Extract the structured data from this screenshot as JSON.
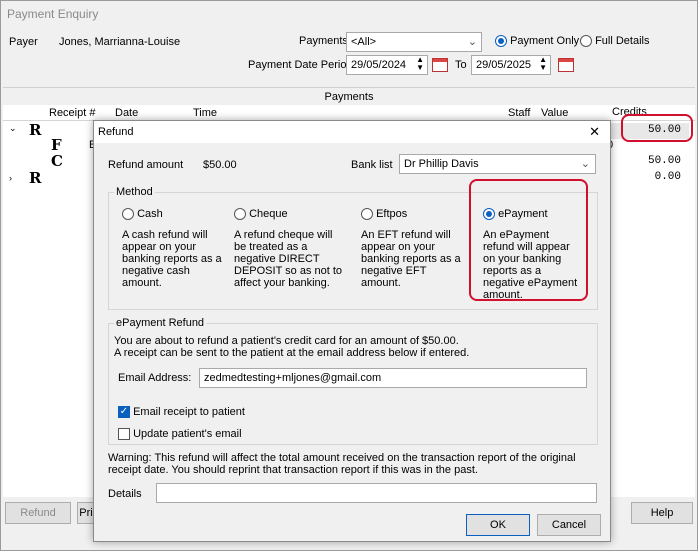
{
  "window": {
    "title": "Payment Enquiry"
  },
  "header": {
    "payer_label": "Payer",
    "payer_name": "Jones, Marrianna-Louise",
    "payments_label": "Payments",
    "payments_select": "<All>",
    "payment_only_label": "Payment Only",
    "full_details_label": "Full Details",
    "period_label": "Payment Date Period",
    "date_from": "29/05/2024",
    "to_label": "To",
    "date_to": "29/05/2025"
  },
  "grid": {
    "section_label": "Payments",
    "columns": [
      "Receipt #",
      "Date",
      "Time",
      "Staff",
      "Value",
      "Credits"
    ],
    "rows": [
      {
        "glyph": "R",
        "credits": "50.00"
      },
      {
        "glyph": "F",
        "note": "E",
        "credits": ""
      },
      {
        "glyph": "C",
        "credits": "50.00"
      },
      {
        "glyph": "R",
        "credits": "0.00"
      }
    ],
    "partial_b": "B",
    "partial_0": "0"
  },
  "bottom_buttons": {
    "refund": "Refund",
    "print": "Pri",
    "help": "Help"
  },
  "dialog": {
    "title": "Refund",
    "close": "✕",
    "refund_amount_label": "Refund amount",
    "refund_amount": "$50.00",
    "bank_list_label": "Bank list",
    "bank_list_value": "Dr Phillip Davis",
    "method_label": "Method",
    "methods": [
      {
        "label": "Cash",
        "desc": "A cash refund will appear on your banking reports as a negative cash amount."
      },
      {
        "label": "Cheque",
        "desc": "A refund cheque will be treated as a negative DIRECT DEPOSIT so as not to affect your banking."
      },
      {
        "label": "Eftpos",
        "desc": "An EFT refund will appear on your banking reports as a negative EFT amount."
      },
      {
        "label": "ePayment",
        "desc": "An ePayment refund will appear on your banking reports as a negative ePayment amount."
      }
    ],
    "epayment_section_label": "ePayment Refund",
    "epayment_info_1": "You are about to refund a patient's credit card for an amount of $50.00.",
    "epayment_info_2": "A receipt can be sent to the patient at the email address below if entered.",
    "email_label": "Email Address:",
    "email_value": "zedmedtesting+mljones@gmail.com",
    "email_receipt_label": "Email receipt to patient",
    "update_email_label": "Update patient's email",
    "warning": "Warning: This refund will affect the total amount received on the transaction report of the original receipt date. You should reprint that transaction report if this was in the past.",
    "details_label": "Details",
    "ok": "OK",
    "cancel": "Cancel"
  },
  "colors": {
    "accent": "#0a5fbf",
    "highlight": "#d0102d"
  }
}
